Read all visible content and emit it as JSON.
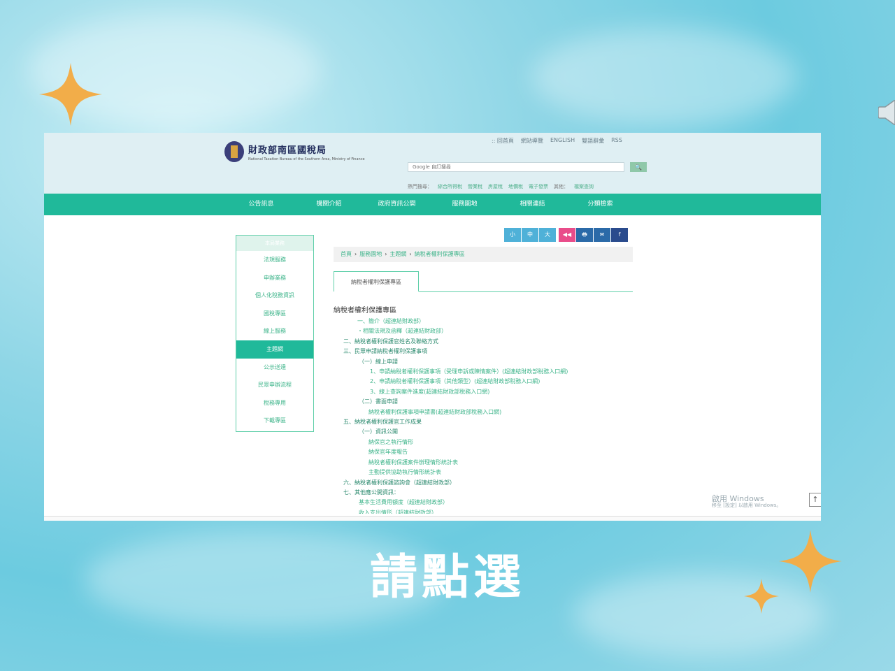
{
  "colors": {
    "nav_green": "#20b99a",
    "header_bg": "#dfeff3",
    "link_green": "#3db48a",
    "star_orange": "#f2ad49"
  },
  "site": {
    "logo_title": "財政部南區國稅局",
    "logo_subtitle": "National Taxation Bureau of the Southern Area, Ministry of Finance",
    "top_links": [
      ":: 回首頁",
      "網站導覽",
      "ENGLISH",
      "雙語辭彙",
      "RSS"
    ],
    "search_placeholder": "Google 自訂搜尋",
    "search_button_icon": "search-icon",
    "hot_keys": {
      "label": "熱門搜尋：",
      "items": [
        "綜合所得稅",
        "營業稅",
        "房屋稅",
        "地價稅",
        "電子發票"
      ],
      "other_label": "其他：",
      "other_item": "檔案查詢"
    },
    "nav": [
      "公告訊息",
      "機關介紹",
      "政府資訊公開",
      "服務園地",
      "相關連結",
      "分類檢索"
    ]
  },
  "tools": [
    "小",
    "中",
    "大",
    "◀◀",
    "🖶",
    "✉",
    "f"
  ],
  "sidebar": {
    "header": "本局業務",
    "items": [
      "法規服務",
      "申辦業務",
      "個人化稅務資訊",
      "國稅專區",
      "線上服務",
      "主題網",
      "公示送達",
      "民眾申辦流程",
      "稅務專用",
      "下載專區"
    ],
    "active_index": 5
  },
  "breadcrumb": [
    "首頁",
    "服務園地",
    "主題網",
    "納稅者權利保護專區"
  ],
  "tab": "納稅者權利保護專區",
  "content": {
    "title": "納稅者權利保護專區",
    "lines": [
      {
        "cls": "c-l l1",
        "text": "一、簡介（超連結財政部）"
      },
      {
        "cls": "c-l l1",
        "text": "・相關法規及函釋（超連結財政部）"
      },
      {
        "cls": "c-h l2",
        "text": "二、納稅者權利保護官姓名及聯絡方式"
      },
      {
        "cls": "c-h l2",
        "text": "三、民眾申請納稅者權利保護事項"
      },
      {
        "cls": "c-h l3",
        "text": "（一）線上申請"
      },
      {
        "cls": "c-l l4",
        "text": "1、申請納稅者權利保護事項（受理申訴或陳情案件）(超連結財政部稅務入口網)"
      },
      {
        "cls": "c-l l4",
        "text": "2、申請納稅者權利保護事項（其他類型）(超連結財政部稅務入口網)"
      },
      {
        "cls": "c-l l4",
        "text": "3、線上查詢案件進度(超連結財政部稅務入口網)"
      },
      {
        "cls": "c-h l3",
        "text": "（二）書面申請"
      },
      {
        "cls": "c-l l5",
        "text": "納稅者權利保護事項申請書(超連結財政部稅務入口網)"
      },
      {
        "cls": "c-h l2",
        "text": "五、納稅者權利保護官工作成果"
      },
      {
        "cls": "c-h l3",
        "text": "（一）資訊公開"
      },
      {
        "cls": "c-l l5",
        "text": "納保官之執行情形"
      },
      {
        "cls": "c-l l5",
        "text": "納保官年度報告"
      },
      {
        "cls": "c-l l5",
        "text": "納稅者權利保護案件辦理情形統計表"
      },
      {
        "cls": "c-l l5",
        "text": "主動提供協助執行情形統計表"
      },
      {
        "cls": "c-h l2",
        "text": "六、納稅者權利保護諮詢會（超連結財政部）"
      },
      {
        "cls": "c-h l2",
        "text": "七、其他應公開資訊："
      },
      {
        "cls": "c-l l3",
        "text": "基本生活費用額度（超連結財政部）"
      },
      {
        "cls": "c-l l3",
        "text": "收入支出情形（超連結財政部）"
      }
    ]
  },
  "windows_watermark": {
    "line1": "啟用 Windows",
    "line2": "移至 [設定] 以啟用 Windows。"
  },
  "caption": "請點選"
}
